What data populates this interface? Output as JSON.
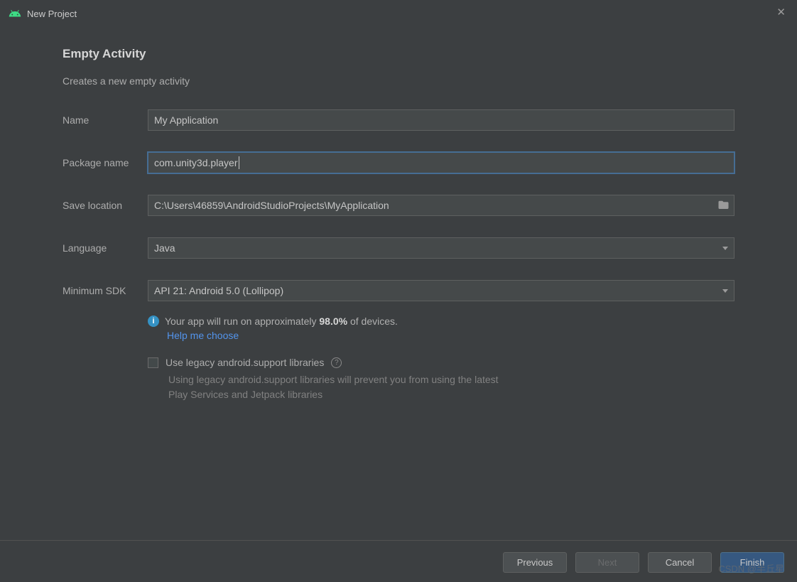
{
  "titlebar": {
    "title": "New Project"
  },
  "page": {
    "heading": "Empty Activity",
    "subheading": "Creates a new empty activity"
  },
  "fields": {
    "name": {
      "label": "Name",
      "value": "My Application"
    },
    "package": {
      "label": "Package name",
      "value": "com.unity3d.player"
    },
    "savelocation": {
      "label": "Save location",
      "value": "C:\\Users\\46859\\AndroidStudioProjects\\MyApplication"
    },
    "language": {
      "label": "Language",
      "value": "Java"
    },
    "minsdk": {
      "label": "Minimum SDK",
      "value": "API 21: Android 5.0 (Lollipop)"
    }
  },
  "info": {
    "text_prefix": "Your app will run on approximately ",
    "percent": "98.0%",
    "text_suffix": " of devices.",
    "help_link": "Help me choose"
  },
  "legacy": {
    "checkbox_label": "Use legacy android.support libraries",
    "description": "Using legacy android.support libraries will prevent you from using the latest Play Services and Jetpack libraries"
  },
  "buttons": {
    "previous": "Previous",
    "next": "Next",
    "cancel": "Cancel",
    "finish": "Finish"
  },
  "watermark": "CSDN @半丘星"
}
